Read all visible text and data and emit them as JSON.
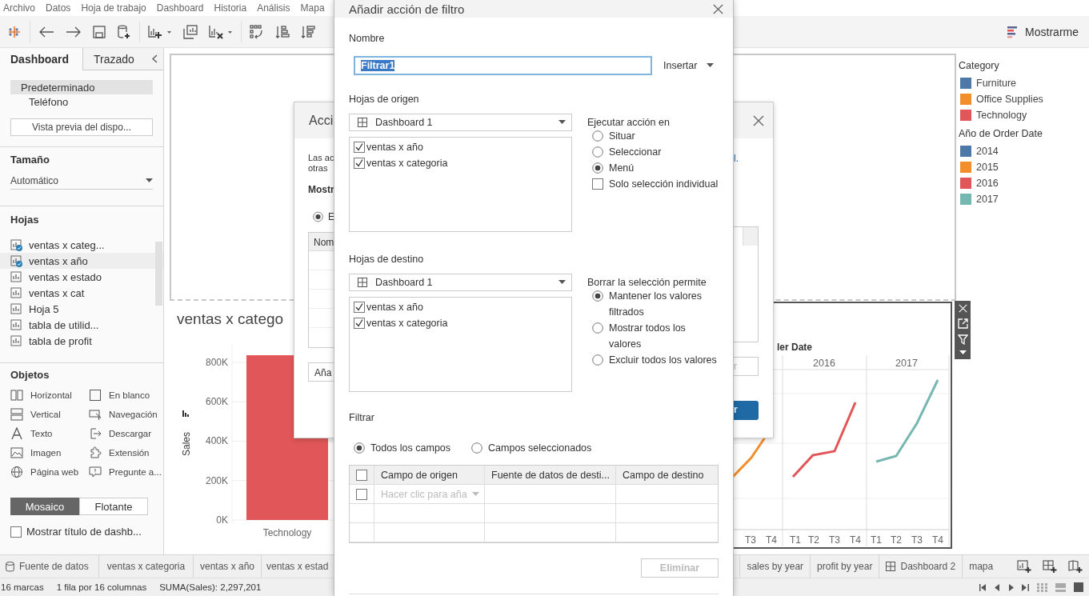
{
  "menu_bar": [
    "Archivo",
    "Datos",
    "Hoja de trabajo",
    "Dashboard",
    "Historia",
    "Análisis",
    "Mapa"
  ],
  "toolbar": {
    "show_me": "Mostrarme"
  },
  "side_panel": {
    "tabs": [
      {
        "label": "Dashboard",
        "selected": true
      },
      {
        "label": "Trazado",
        "selected": false
      }
    ],
    "devices": [
      {
        "label": "Predeterminado",
        "selected": true
      },
      {
        "label": "Teléfono",
        "selected": false
      }
    ],
    "preview_button": "Vista previa del dispo...",
    "size_title": "Tamaño",
    "size_value": "Automático",
    "sheets_title": "Hojas",
    "sheets": [
      {
        "label": "ventas x categ...",
        "in_use": true,
        "highlighted": false
      },
      {
        "label": "ventas x año",
        "in_use": true,
        "highlighted": true
      },
      {
        "label": "ventas x estado",
        "in_use": false,
        "highlighted": false
      },
      {
        "label": "ventas x cat",
        "in_use": false,
        "highlighted": false
      },
      {
        "label": "Hoja 5",
        "in_use": false,
        "highlighted": false
      },
      {
        "label": "tabla de utilid...",
        "in_use": false,
        "highlighted": false
      },
      {
        "label": "tabla de profit",
        "in_use": false,
        "highlighted": false
      }
    ],
    "objects_title": "Objetos",
    "objects": [
      {
        "label": "Horizontal",
        "kind": "horizontal"
      },
      {
        "label": "En blanco",
        "kind": "blank"
      },
      {
        "label": "Vertical",
        "kind": "vertical"
      },
      {
        "label": "Navegación",
        "kind": "navigation"
      },
      {
        "label": "Texto",
        "kind": "text"
      },
      {
        "label": "Descargar",
        "kind": "download"
      },
      {
        "label": "Imagen",
        "kind": "image"
      },
      {
        "label": "Extensión",
        "kind": "extension"
      },
      {
        "label": "Página web",
        "kind": "web"
      },
      {
        "label": "Pregunte a...",
        "kind": "ask"
      }
    ],
    "layout_modes": [
      {
        "label": "Mosaico",
        "selected": true
      },
      {
        "label": "Flotante",
        "selected": false
      }
    ],
    "show_title": {
      "label": "Mostrar título de dashb...",
      "checked": false
    }
  },
  "dashboard": {
    "bar_chart": {
      "title": "ventas x catego",
      "chart_data": {
        "type": "bar",
        "ylabel": "Sales",
        "categories": [
          "Technology"
        ],
        "values": [
          836000
        ],
        "ylim": [
          0,
          893000
        ],
        "grid": true,
        "yticks": [
          {
            "value": 0,
            "label": "0K"
          },
          {
            "value": 200000,
            "label": "200K"
          },
          {
            "value": 400000,
            "label": "400K"
          },
          {
            "value": 600000,
            "label": "600K"
          },
          {
            "value": 800000,
            "label": "800K"
          }
        ]
      }
    },
    "line_chart": {
      "header": "ler Date",
      "years": [
        "2016",
        "2017"
      ],
      "quarters": [
        "T3",
        "T4",
        "T1",
        "T2",
        "T3",
        "T4",
        "T1",
        "T2",
        "T3",
        "T4"
      ]
    },
    "legends": [
      {
        "title": "Category",
        "items": [
          {
            "label": "Furniture",
            "color": "#4e79a7"
          },
          {
            "label": "Office Supplies",
            "color": "#f28e2b"
          },
          {
            "label": "Technology",
            "color": "#e15759"
          }
        ]
      },
      {
        "title": "Año de Order Date",
        "items": [
          {
            "label": "2014",
            "color": "#4e79a7"
          },
          {
            "label": "2015",
            "color": "#f28e2b"
          },
          {
            "label": "2016",
            "color": "#e15759"
          },
          {
            "label": "2017",
            "color": "#76b7b2"
          }
        ]
      }
    ]
  },
  "sheet_tabs_left": [
    {
      "label": "Fuente de datos",
      "kind": "datasource"
    },
    {
      "label": "ventas x categoria",
      "kind": "sheet"
    },
    {
      "label": "ventas x año",
      "kind": "sheet"
    },
    {
      "label": "ventas x estad",
      "kind": "sheet"
    }
  ],
  "sheet_tabs_right": [
    {
      "label": "sales by year",
      "kind": "sheet"
    },
    {
      "label": "profit by year",
      "kind": "sheet"
    },
    {
      "label": "Dashboard 2",
      "kind": "dashboard"
    },
    {
      "label": "mapa",
      "kind": "sheet"
    }
  ],
  "status_bar": [
    "16 marcas",
    "1 fila por 16 columnas",
    "SUMA(Sales): 2,297,201"
  ],
  "behind_dialog": {
    "title": "Acci",
    "intro_lines": [
      "Las ac",
      "otras"
    ],
    "link_fragment": "l.",
    "section": "Mostr",
    "radio": {
      "label": "E",
      "selected": true
    },
    "table_header": "Nom",
    "add_button": "Aña",
    "field_fragment": "r",
    "button_fragment": "r"
  },
  "filter_dialog": {
    "title": "Añadir acción de filtro",
    "name_label": "Nombre",
    "name_value": "Filtrar1",
    "insert_button": "Insertar",
    "source": {
      "title": "Hojas de origen",
      "dashboard": "Dashboard 1",
      "sheets": [
        {
          "label": "ventas x año",
          "checked": true
        },
        {
          "label": "ventas x categoria",
          "checked": true
        }
      ]
    },
    "run_on": {
      "title": "Ejecutar acción en",
      "options": [
        {
          "label": "Situar",
          "selected": false
        },
        {
          "label": "Seleccionar",
          "selected": false
        },
        {
          "label": "Menú",
          "selected": true
        }
      ],
      "single": {
        "label": "Solo selección individual",
        "checked": false
      }
    },
    "target": {
      "title": "Hojas de destino",
      "dashboard": "Dashboard 1",
      "sheets": [
        {
          "label": "ventas x año",
          "checked": true
        },
        {
          "label": "ventas x categoria",
          "checked": true
        }
      ]
    },
    "clearing": {
      "title": "Borrar la selección permite",
      "options": [
        {
          "label": "Mantener los valores filtrados",
          "selected": true
        },
        {
          "label": "Mostrar todos los valores",
          "selected": false
        },
        {
          "label": "Excluir todos los valores",
          "selected": false
        }
      ]
    },
    "filter": {
      "title": "Filtrar",
      "options": [
        {
          "label": "Todos los campos",
          "selected": true
        },
        {
          "label": "Campos seleccionados",
          "selected": false
        }
      ],
      "columns": [
        "Campo de origen",
        "Fuente de datos de desti...",
        "Campo de destino"
      ],
      "select_all_checked": false,
      "row_checked": false,
      "add_placeholder": "Hacer clic para aña"
    },
    "delete_button": {
      "label": "Eliminar",
      "disabled": true
    }
  }
}
